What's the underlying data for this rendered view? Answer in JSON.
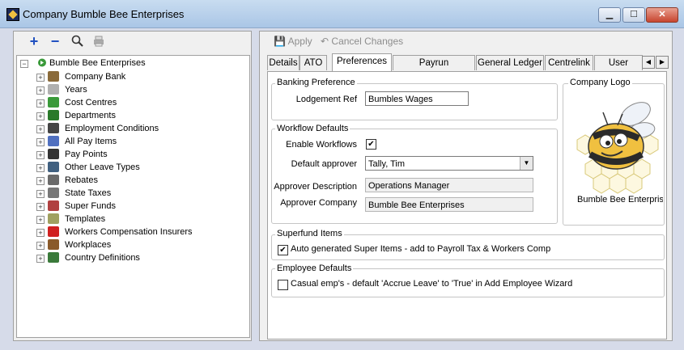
{
  "window": {
    "title": "Company Bumble Bee Enterprises",
    "min": "▭",
    "max": "☐",
    "close": "✕"
  },
  "left_toolbar": {
    "add_icon": "+",
    "remove_icon": "−",
    "search_icon": "🔍",
    "print_icon": "🖨"
  },
  "tree": {
    "root": "Bumble Bee Enterprises",
    "items": [
      {
        "label": "Company Bank",
        "icon": "bank-icon"
      },
      {
        "label": "Years",
        "icon": "calendar-icon"
      },
      {
        "label": "Cost Centres",
        "icon": "cost-centres-icon"
      },
      {
        "label": "Departments",
        "icon": "departments-icon"
      },
      {
        "label": "Employment Conditions",
        "icon": "document-icon"
      },
      {
        "label": "All Pay Items",
        "icon": "pay-items-icon"
      },
      {
        "label": "Pay Points",
        "icon": "pay-points-icon"
      },
      {
        "label": "Other Leave Types",
        "icon": "plane-icon"
      },
      {
        "label": "Rebates",
        "icon": "rebates-icon"
      },
      {
        "label": "State Taxes",
        "icon": "state-taxes-icon"
      },
      {
        "label": "Super Funds",
        "icon": "super-funds-icon"
      },
      {
        "label": "Templates",
        "icon": "templates-icon"
      },
      {
        "label": "Workers Compensation Insurers",
        "icon": "red-cross-icon"
      },
      {
        "label": "Workplaces",
        "icon": "workplaces-icon"
      },
      {
        "label": "Country Definitions",
        "icon": "globe-icon"
      }
    ]
  },
  "right_toolbar": {
    "apply": "Apply",
    "cancel": "Cancel Changes"
  },
  "tabs": [
    "Details",
    "ATO",
    "Preferences",
    "Payrun Preferences",
    "General Ledger",
    "Centrelink",
    "User Define"
  ],
  "active_tab": "Preferences",
  "banking": {
    "title": "Banking Preference",
    "lodgement_ref_label": "Lodgement Ref",
    "lodgement_ref_value": "Bumbles Wages"
  },
  "workflow": {
    "title": "Workflow Defaults",
    "enable_label": "Enable Workflows",
    "enable_checked": true,
    "approver_label": "Default approver",
    "approver_value": "Tally, Tim",
    "desc_label": "Approver Description",
    "desc_value": "Operations Manager",
    "company_label": "Approver Company",
    "company_value": "Bumble Bee Enterprises"
  },
  "logo": {
    "title": "Company Logo",
    "caption": "Bumble Bee Enterpris"
  },
  "superfund": {
    "title": "Superfund Items",
    "label": "Auto generated Super Items - add to Payroll Tax & Workers Comp",
    "checked": true
  },
  "employee_defaults": {
    "title": "Employee Defaults",
    "label": "Casual emp's - default 'Accrue Leave' to 'True' in Add Employee Wizard",
    "checked": false
  },
  "colors": {
    "accent": "#1c2a5a",
    "close": "#c8452f",
    "bee_yellow": "#f0c040"
  }
}
